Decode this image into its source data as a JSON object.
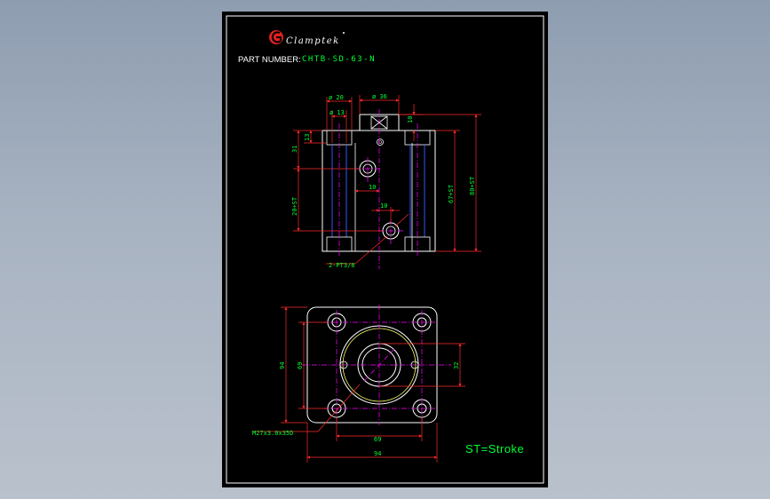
{
  "header": {
    "brand": "Clamptek",
    "part_label": "PART NUMBER:",
    "part_number": "CHTB-SD-63-N"
  },
  "front_view": {
    "dim_dia20": "ø 20",
    "dim_dia13": "ø 13",
    "dim_dia36": "ø 36",
    "dim_10_top": "10",
    "dim_13": "13",
    "dim_31": "31",
    "dim_20st": "20+ST",
    "dim_10_a": "10",
    "dim_10_b": "10",
    "dim_67st": "67+ST",
    "dim_80st": "80+ST",
    "port_note": "2-PT3/8"
  },
  "top_view": {
    "dim_94_left": "94",
    "dim_69_left": "69",
    "dim_32": "32",
    "dim_69_bottom": "69",
    "dim_94_bottom": "94",
    "thread_note": "M27x3.0x35D"
  },
  "footnote": "ST=Stroke",
  "colors": {
    "outline": "#ffffff",
    "dimension": "#ff2a2a",
    "center": "#ff00ff",
    "hidden": "#3355ff",
    "text": "#00ff33",
    "logo": "#e02020",
    "thread": "#ffff66"
  }
}
